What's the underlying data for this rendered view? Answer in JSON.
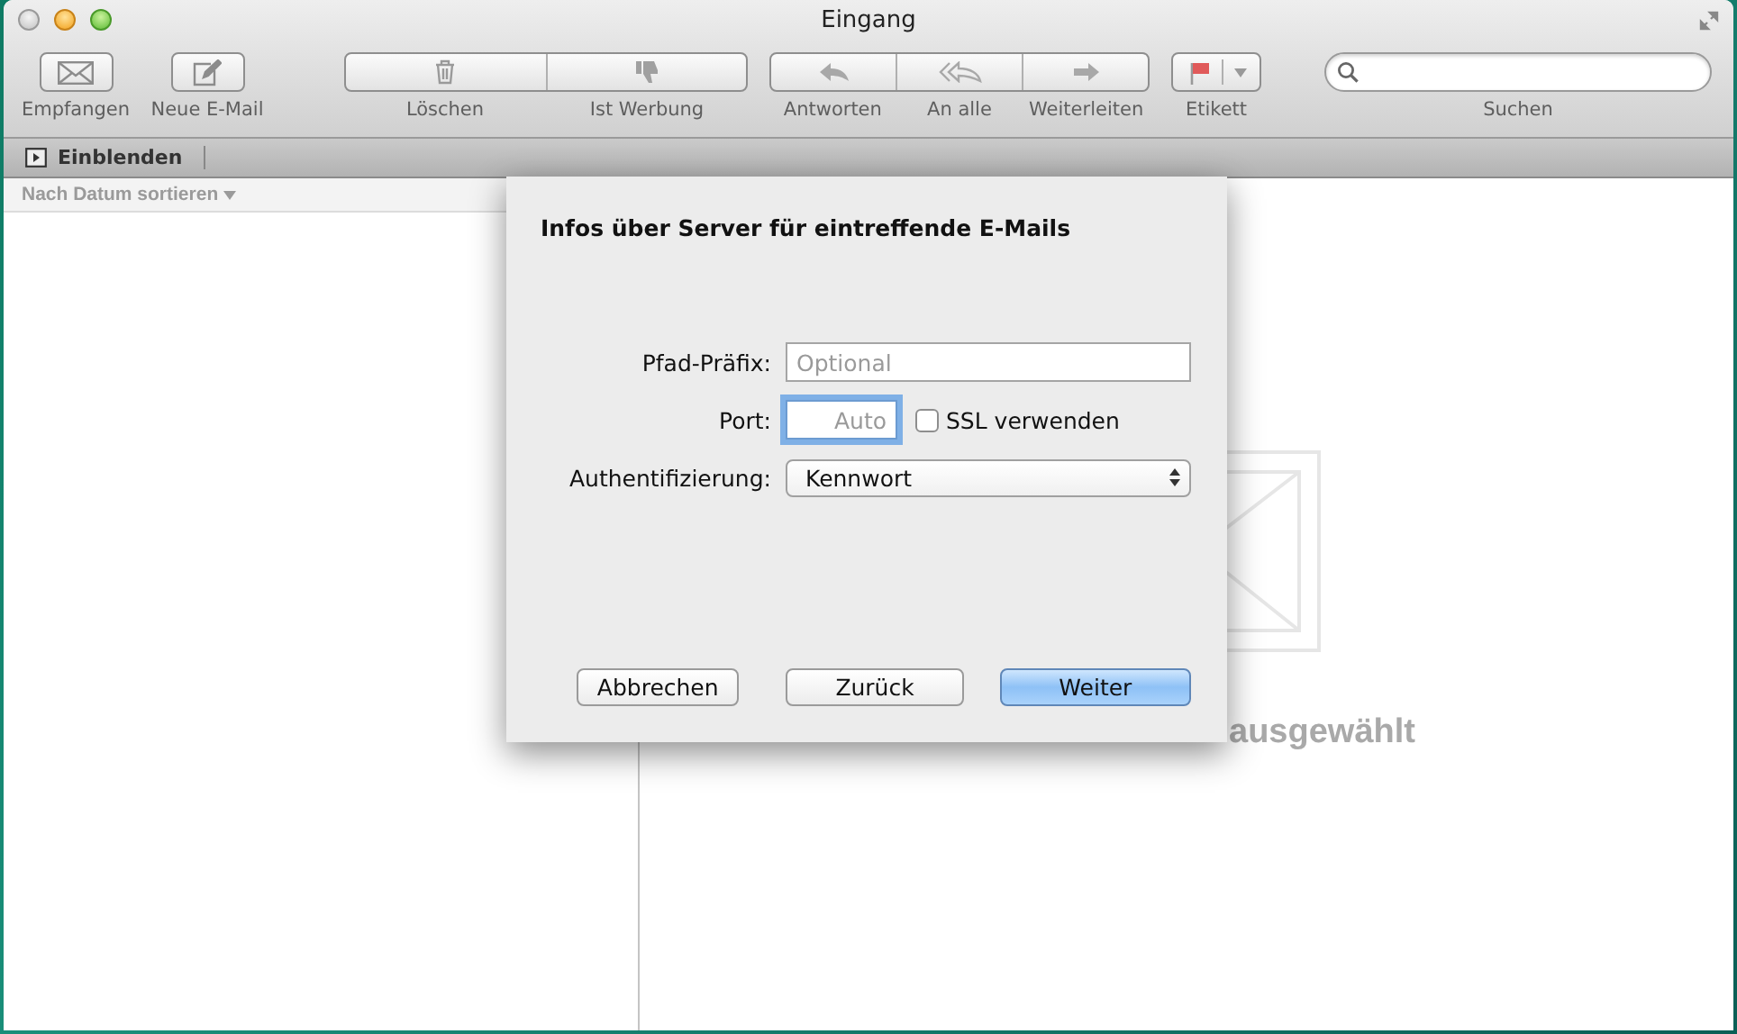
{
  "window": {
    "title": "Eingang"
  },
  "toolbar": [
    {
      "kind": "button",
      "label": "Empfangen"
    },
    {
      "kind": "button",
      "label": "Neue E-Mail"
    },
    {
      "kind": "segmented",
      "labels": [
        "Löschen",
        "Ist Werbung"
      ]
    },
    {
      "kind": "segmented",
      "labels": [
        "Antworten",
        "An alle",
        "Weiterleiten"
      ]
    },
    {
      "kind": "menu",
      "label": "Etikett"
    },
    {
      "kind": "search",
      "label": "Suchen"
    }
  ],
  "favorites_bar": {
    "button": "Einblenden"
  },
  "message_list": {
    "sort_label": "Nach Datum sortieren"
  },
  "message_view": {
    "empty_text": "ausgewählt"
  },
  "dialog": {
    "title": "Infos über Server für eintreffende E-Mails",
    "fields": [
      {
        "kind": "text",
        "label": "Pfad-Präfix:",
        "placeholder": "Optional",
        "focused": false
      },
      {
        "kind": "port",
        "label": "Port:",
        "placeholder": "Auto",
        "focused": true,
        "checkbox": {
          "label": "SSL verwenden",
          "checked": false
        }
      },
      {
        "kind": "select",
        "label": "Authentifizierung:",
        "value": "Kennwort"
      }
    ],
    "buttons": [
      {
        "label": "Abbrechen",
        "default": false
      },
      {
        "label": "Zurück",
        "default": false
      },
      {
        "label": "Weiter",
        "default": true
      }
    ]
  }
}
